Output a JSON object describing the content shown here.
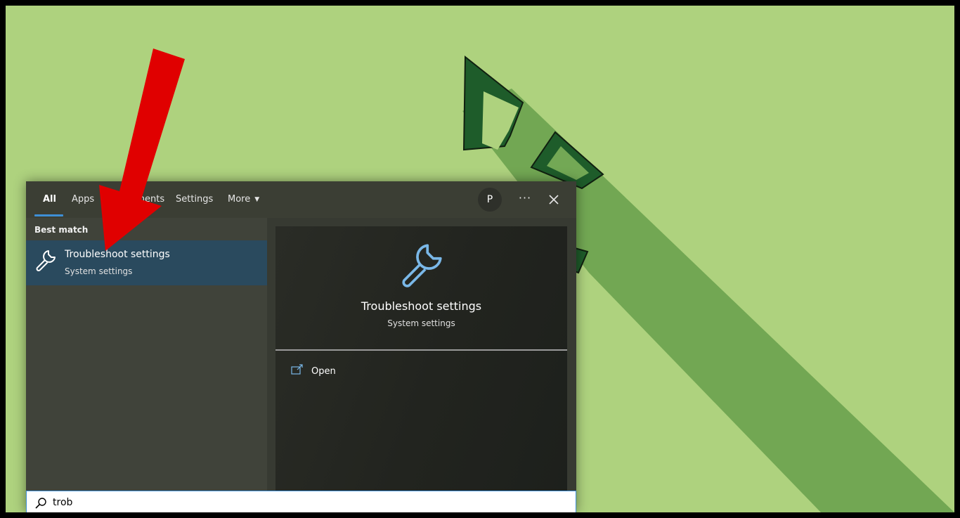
{
  "tabs": [
    {
      "label": "All",
      "active": true
    },
    {
      "label": "Apps"
    },
    {
      "label": "Documents"
    },
    {
      "label": "Settings"
    },
    {
      "label": "More"
    }
  ],
  "header": {
    "avatar_initial": "P",
    "more_options_label": "···"
  },
  "results": {
    "section_label": "Best match",
    "best_match": {
      "title": "Troubleshoot settings",
      "subtitle": "System settings",
      "icon": "wrench-icon"
    }
  },
  "preview": {
    "title": "Troubleshoot settings",
    "subtitle": "System settings",
    "icon": "wrench-icon",
    "actions": [
      {
        "label": "Open",
        "icon": "open-window-icon"
      }
    ]
  },
  "search": {
    "value": "trob",
    "icon": "search-icon"
  },
  "colors": {
    "wallpaper": "#aed27e",
    "accent": "#3e8fd6",
    "selected_item": "#2a4a5e",
    "annotation_arrow": "#e00000"
  }
}
